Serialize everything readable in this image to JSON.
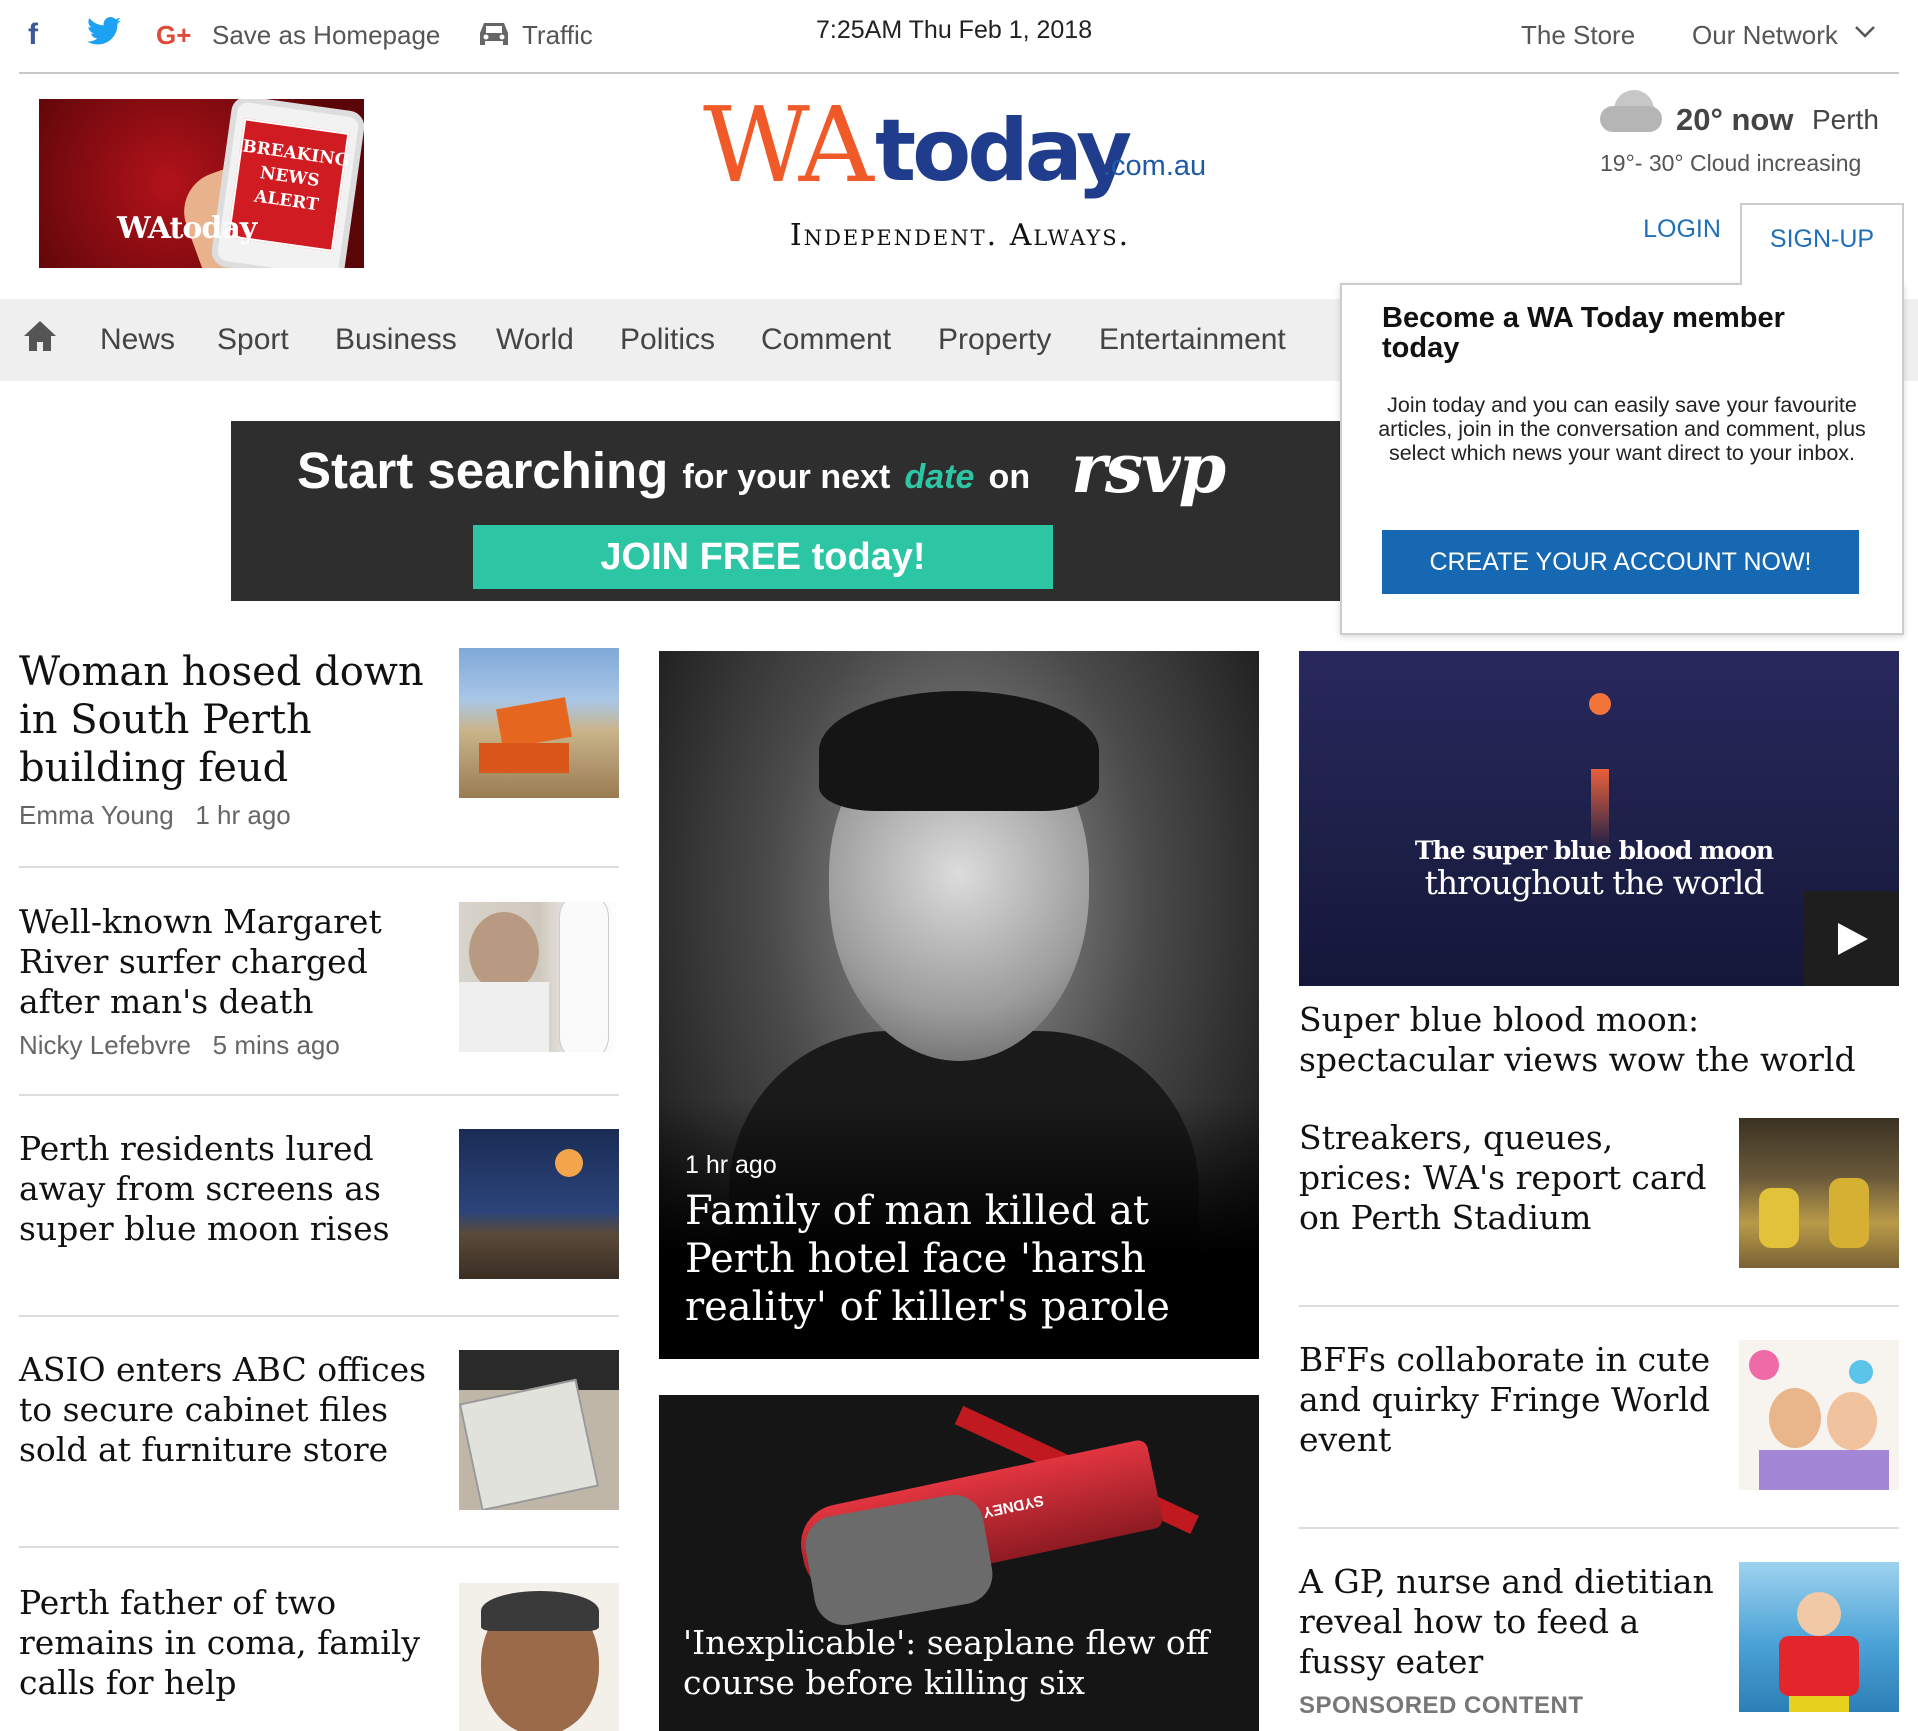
{
  "topbar": {
    "facebook_icon": "facebook-icon",
    "twitter_icon": "twitter-icon",
    "googleplus_icon": "googleplus-icon",
    "save_homepage": "Save as Homepage",
    "traffic": "Traffic",
    "datetime": "7:25AM Thu Feb 1, 2018",
    "store": "The Store",
    "network": "Our Network"
  },
  "promo": {
    "phone_text_1": "BREAKING",
    "phone_text_2": "NEWS",
    "phone_text_3": "ALERT",
    "brand": "WAtoday"
  },
  "logo": {
    "wa": "WA",
    "today": "today",
    "domain": ".com.au",
    "tagline": "Independent. Always."
  },
  "weather": {
    "now": "20° now",
    "city": "Perth",
    "range": "19°- 30°  Cloud increasing"
  },
  "auth": {
    "login": "LOGIN",
    "signup": "SIGN-UP"
  },
  "nav": {
    "items": [
      "News",
      "Sport",
      "Business",
      "World",
      "Politics",
      "Comment",
      "Property",
      "Entertainment"
    ]
  },
  "ad": {
    "line_big": "Start searching",
    "line_small_1": "for your next",
    "line_date": "date",
    "line_small_2": "on",
    "brand": "rsvp",
    "cta": "JOIN FREE today!"
  },
  "popover": {
    "heading": "Become a WA Today member today",
    "body": "Join today and you can easily save your favourite articles, join in the conversation and comment, plus select which news your want direct to your inbox.",
    "button": "CREATE YOUR ACCOUNT NOW!"
  },
  "left_stories": [
    {
      "headline": "Woman hosed down in South Perth building feud",
      "author": "Emma Young",
      "time": "1 hr ago"
    },
    {
      "headline": "Well-known Margaret River surfer charged after man's death",
      "author": "Nicky Lefebvre",
      "time": "5 mins ago"
    },
    {
      "headline": "Perth residents lured away from screens as super blue moon rises"
    },
    {
      "headline": "ASIO enters ABC offices to secure cabinet files sold at furniture store"
    },
    {
      "headline": "Perth father of two remains in coma, family calls for help"
    }
  ],
  "featured": {
    "time": "1 hr ago",
    "headline": "Family of man killed at Perth hotel face 'harsh reality' of killer's parole"
  },
  "featured2": {
    "headline": "'Inexplicable': seaplane flew off course before killing six",
    "plane_text": "SYDNEY SEAPLANES"
  },
  "video": {
    "overlay_1": "The super blue blood moon",
    "overlay_2": "throughout the world",
    "headline": "Super blue blood moon: spectacular views wow the world"
  },
  "right_stories": [
    {
      "headline": "Streakers, queues, prices: WA's report card on Perth Stadium"
    },
    {
      "headline": "BFFs collaborate in cute and quirky Fringe World event"
    },
    {
      "headline": "A GP, nurse and dietitian reveal how to feed a fussy eater",
      "label": "SPONSORED CONTENT"
    }
  ],
  "colors": {
    "brand_orange": "#f05a28",
    "brand_blue": "#1f3d8c",
    "link_blue": "#1f6fb8",
    "button_blue": "#1668b3",
    "rsvp_green": "#2dc6a4"
  }
}
